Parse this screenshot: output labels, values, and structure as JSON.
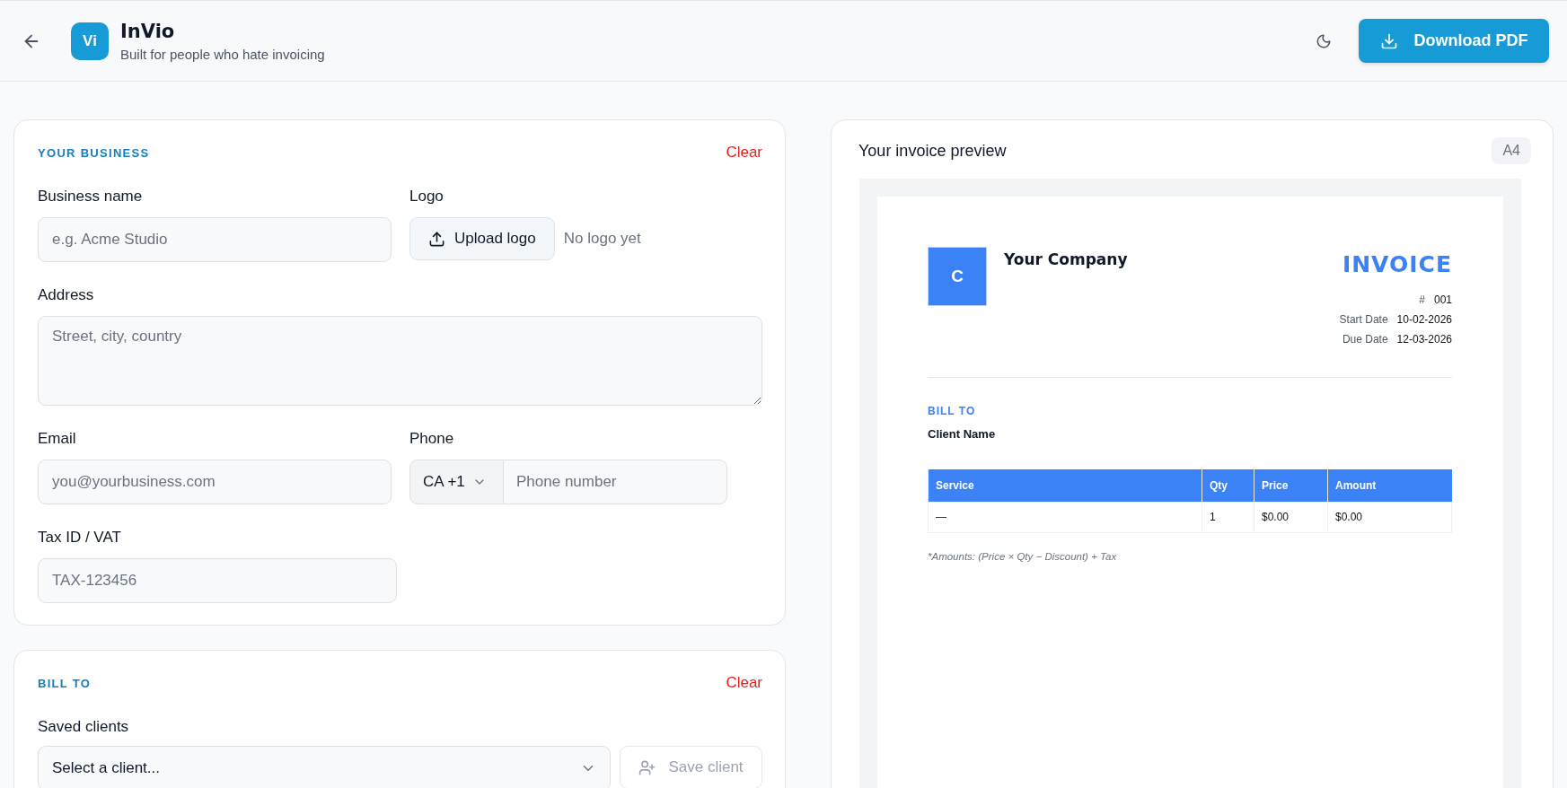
{
  "header": {
    "logo_mark": "Vi",
    "title": "InVio",
    "subtitle": "Built for people who hate invoicing",
    "download_button": "Download PDF"
  },
  "business": {
    "title": "YOUR BUSINESS",
    "clear": "Clear",
    "business_name": {
      "label": "Business name",
      "placeholder": "e.g. Acme Studio"
    },
    "logo": {
      "label": "Logo",
      "button": "Upload logo",
      "status": "No logo yet"
    },
    "address": {
      "label": "Address",
      "placeholder": "Street, city, country"
    },
    "email": {
      "label": "Email",
      "placeholder": "you@yourbusiness.com"
    },
    "phone": {
      "label": "Phone",
      "country": "CA +1",
      "placeholder": "Phone number"
    },
    "tax_id": {
      "label": "Tax ID / VAT",
      "placeholder": "TAX-123456"
    }
  },
  "bill_to": {
    "title": "BILL TO",
    "clear": "Clear",
    "saved_clients": {
      "label": "Saved clients",
      "value": "Select a client..."
    },
    "save_client": {
      "label": "Save client",
      "disabled": true
    }
  },
  "preview": {
    "title": "Your invoice preview",
    "paper_size": "A4",
    "invoice": {
      "logo_letter": "C",
      "company": "Your Company",
      "heading": "INVOICE",
      "meta": [
        {
          "label": "#",
          "value": "001"
        },
        {
          "label": "Start Date",
          "value": "10-02-2026"
        },
        {
          "label": "Due Date",
          "value": "12-03-2026"
        }
      ],
      "bill_to_label": "BILL TO",
      "client_name": "Client Name",
      "table": {
        "columns": [
          "Service",
          "Qty",
          "Price",
          "Amount"
        ],
        "rows": [
          [
            "—",
            "1",
            "$0.00",
            "$0.00"
          ]
        ]
      },
      "note": "*Amounts: (Price × Qty − Discount) + Tax"
    }
  }
}
